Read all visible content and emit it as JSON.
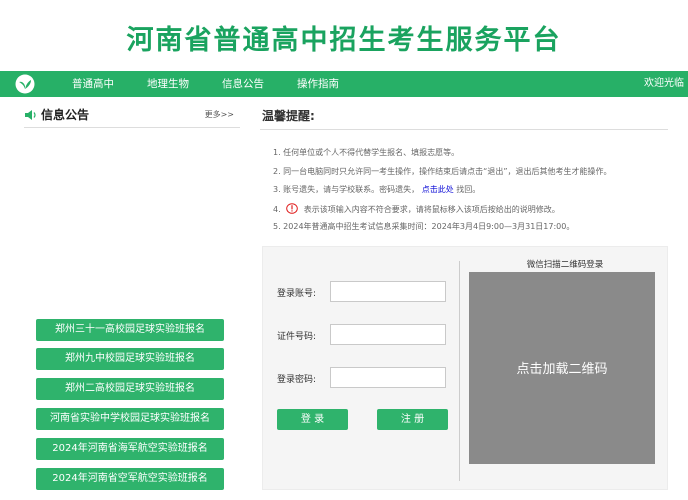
{
  "header": {
    "title": "河南省普通高中招生考生服务平台"
  },
  "nav": {
    "items": [
      "普通高中",
      "地理生物",
      "信息公告",
      "操作指南"
    ],
    "welcome": "欢迎光临"
  },
  "notice": {
    "title": "信息公告",
    "more": "更多>>",
    "buttons": [
      "郑州三十一高校园足球实验班报名",
      "郑州九中校园足球实验班报名",
      "郑州二高校园足球实验班报名",
      "河南省实验中学校园足球实验班报名",
      "2024年河南省海军航空实验班报名",
      "2024年河南省空军航空实验班报名"
    ]
  },
  "tips": {
    "title": "温馨提醒:",
    "items": [
      "1. 任何单位或个人不得代替学生报名、填报志愿等。",
      "2. 同一台电脑同时只允许同一考生操作，操作结束后请点击“退出”，退出后其他考生才能操作。",
      "3. 账号遗失，请与学校联系。密码遗失，",
      "点击此处",
      "找回。",
      "4.",
      "表示该项输入内容不符合要求，请将鼠标移入该项后按给出的说明修改。",
      "5. 2024年普通高中招生考试信息采集时间：2024年3月4日9:00—3月31日17:00。"
    ]
  },
  "login": {
    "account_label": "登录账号:",
    "id_label": "证件号码:",
    "password_label": "登录密码:",
    "account_value": "",
    "id_value": "",
    "password_value": "",
    "login_btn": "登 录",
    "register_btn": "注 册",
    "qr_title": "微信扫描二维码登录",
    "qr_text": "点击加载二维码"
  },
  "colors": {
    "brand_green": "#27b067",
    "warn_red": "#e02020",
    "link_blue": "#0a0ad6"
  }
}
